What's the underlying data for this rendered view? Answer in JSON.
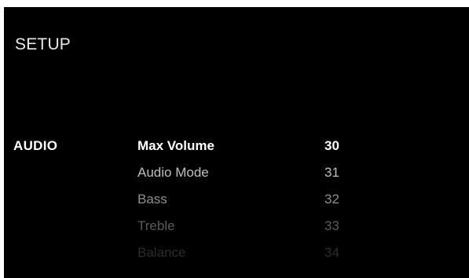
{
  "screen": {
    "title": "SETUP",
    "category": "AUDIO"
  },
  "menu": {
    "items": [
      {
        "label": "Max Volume",
        "value": "30"
      },
      {
        "label": "Audio Mode",
        "value": "31"
      },
      {
        "label": "Bass",
        "value": "32"
      },
      {
        "label": "Treble",
        "value": "33"
      },
      {
        "label": "Balance",
        "value": "34"
      }
    ]
  },
  "colors": {
    "background": "#000000",
    "selected_text": "#ffffff",
    "fading_text": [
      "#bfbfbf",
      "#8f8f8f",
      "#5a5a5a",
      "#2b2b2b"
    ]
  }
}
